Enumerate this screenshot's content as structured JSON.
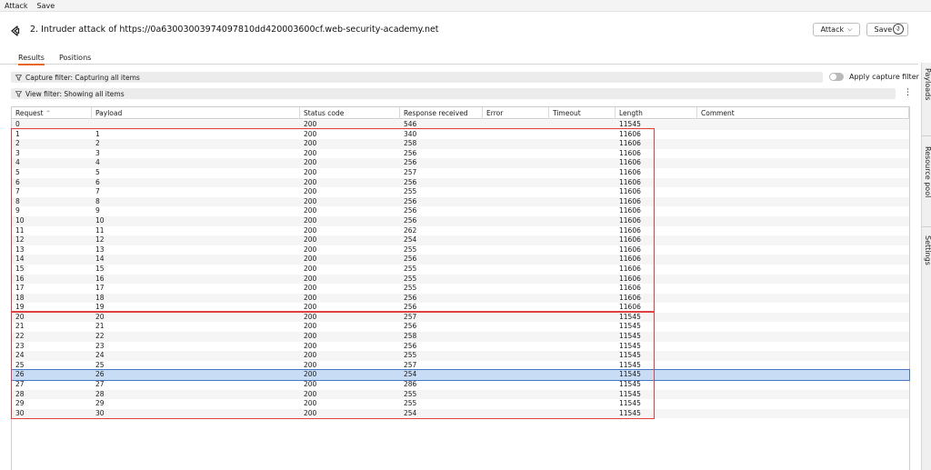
{
  "menu": [
    "Attack",
    "Save"
  ],
  "window": {
    "title": "2. Intruder attack of https://0a63003003974097810dd420003600cf.web-security-academy.net",
    "attack_button": "Attack",
    "save_button": "Save"
  },
  "tabs": [
    "Results",
    "Positions"
  ],
  "active_tab": "Results",
  "sidebar": [
    "Payloads",
    "Resource pool",
    "Settings"
  ],
  "filters": {
    "capture": "Capture filter: Capturing all items",
    "view": "View filter: Showing all items",
    "apply_capture": "Apply capture filter",
    "apply_capture_on": false
  },
  "columns": [
    "Request",
    "Payload",
    "Status code",
    "Response received",
    "Error",
    "Timeout",
    "Length",
    "Comment"
  ],
  "sort": {
    "column": "Request",
    "direction": "ascending"
  },
  "rows": [
    [
      "0",
      "",
      "200",
      "546",
      "",
      "",
      "11545",
      ""
    ],
    [
      "1",
      "1",
      "200",
      "340",
      "",
      "",
      "11606",
      ""
    ],
    [
      "2",
      "2",
      "200",
      "258",
      "",
      "",
      "11606",
      ""
    ],
    [
      "3",
      "3",
      "200",
      "256",
      "",
      "",
      "11606",
      ""
    ],
    [
      "4",
      "4",
      "200",
      "256",
      "",
      "",
      "11606",
      ""
    ],
    [
      "5",
      "5",
      "200",
      "257",
      "",
      "",
      "11606",
      ""
    ],
    [
      "6",
      "6",
      "200",
      "256",
      "",
      "",
      "11606",
      ""
    ],
    [
      "7",
      "7",
      "200",
      "255",
      "",
      "",
      "11606",
      ""
    ],
    [
      "8",
      "8",
      "200",
      "256",
      "",
      "",
      "11606",
      ""
    ],
    [
      "9",
      "9",
      "200",
      "256",
      "",
      "",
      "11606",
      ""
    ],
    [
      "10",
      "10",
      "200",
      "256",
      "",
      "",
      "11606",
      ""
    ],
    [
      "11",
      "11",
      "200",
      "262",
      "",
      "",
      "11606",
      ""
    ],
    [
      "12",
      "12",
      "200",
      "254",
      "",
      "",
      "11606",
      ""
    ],
    [
      "13",
      "13",
      "200",
      "255",
      "",
      "",
      "11606",
      ""
    ],
    [
      "14",
      "14",
      "200",
      "256",
      "",
      "",
      "11606",
      ""
    ],
    [
      "15",
      "15",
      "200",
      "255",
      "",
      "",
      "11606",
      ""
    ],
    [
      "16",
      "16",
      "200",
      "255",
      "",
      "",
      "11606",
      ""
    ],
    [
      "17",
      "17",
      "200",
      "255",
      "",
      "",
      "11606",
      ""
    ],
    [
      "18",
      "18",
      "200",
      "256",
      "",
      "",
      "11606",
      ""
    ],
    [
      "19",
      "19",
      "200",
      "256",
      "",
      "",
      "11606",
      ""
    ],
    [
      "20",
      "20",
      "200",
      "257",
      "",
      "",
      "11545",
      ""
    ],
    [
      "21",
      "21",
      "200",
      "256",
      "",
      "",
      "11545",
      ""
    ],
    [
      "22",
      "22",
      "200",
      "258",
      "",
      "",
      "11545",
      ""
    ],
    [
      "23",
      "23",
      "200",
      "256",
      "",
      "",
      "11545",
      ""
    ],
    [
      "24",
      "24",
      "200",
      "255",
      "",
      "",
      "11545",
      ""
    ],
    [
      "25",
      "25",
      "200",
      "257",
      "",
      "",
      "11545",
      ""
    ],
    [
      "26",
      "26",
      "200",
      "254",
      "",
      "",
      "11545",
      ""
    ],
    [
      "27",
      "27",
      "200",
      "286",
      "",
      "",
      "11545",
      ""
    ],
    [
      "28",
      "28",
      "200",
      "255",
      "",
      "",
      "11545",
      ""
    ],
    [
      "29",
      "29",
      "200",
      "255",
      "",
      "",
      "11545",
      ""
    ],
    [
      "30",
      "30",
      "200",
      "254",
      "",
      "",
      "11545",
      ""
    ]
  ],
  "selected_row": 26,
  "highlight_groups": [
    {
      "first_row": 1,
      "last_row": 19
    },
    {
      "first_row": 20,
      "last_row": 30
    }
  ],
  "colors": {
    "accent": "#e8661d",
    "highlight": "#e04040",
    "selection": "#c8dcf5"
  }
}
